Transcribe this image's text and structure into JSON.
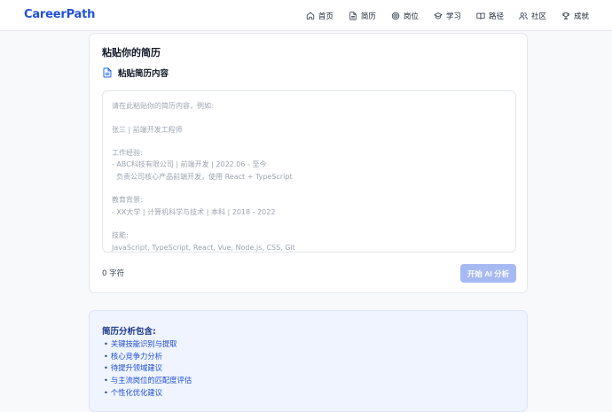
{
  "app": {
    "logo": "CareerPath"
  },
  "nav": [
    {
      "label": "首页",
      "icon": "home-icon"
    },
    {
      "label": "简历",
      "icon": "file-icon"
    },
    {
      "label": "岗位",
      "icon": "target-icon"
    },
    {
      "label": "学习",
      "icon": "graduation-cap-icon"
    },
    {
      "label": "路径",
      "icon": "book-icon"
    },
    {
      "label": "社区",
      "icon": "users-icon"
    },
    {
      "label": "成就",
      "icon": "trophy-icon"
    }
  ],
  "resume_card": {
    "title": "粘贴你的简历",
    "subtitle": "粘贴简历内容",
    "placeholder": "请在此粘贴你的简历内容，例如:\n\n张三 | 前端开发工程师\n\n工作经验:\n- ABC科技有限公司 | 前端开发 | 2022.06 - 至今\n  负责公司核心产品前端开发，使用 React + TypeScript\n\n教育背景:\n- XX大学 | 计算机科学与技术 | 本科 | 2018 - 2022\n\n技能:\nJavaScript, TypeScript, React, Vue, Node.js, CSS, Git",
    "value": "",
    "char_count": "0 字符",
    "analyze_button": "开始 AI 分析"
  },
  "info_box": {
    "title": "简历分析包含:",
    "items": [
      "关键技能识别与提取",
      "核心竞争力分析",
      "待提升领域建议",
      "与主流岗位的匹配度评估",
      "个性化优化建议"
    ]
  },
  "colors": {
    "brand": "#2151d6",
    "button_disabled": "#a6b9f2",
    "info_bg": "#eff4fe",
    "info_text": "#1d4ed8"
  }
}
